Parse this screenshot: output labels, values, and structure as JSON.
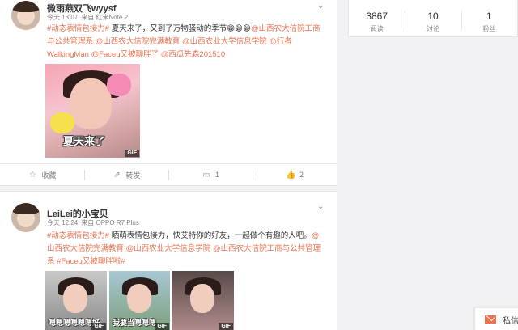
{
  "posts": [
    {
      "author": "微雨燕双飞wyysf",
      "time": "今天 13:07",
      "via": "来自 红米Note 2",
      "text": [
        {
          "t": "#动态表情包接力#",
          "link": true
        },
        {
          "t": " 夏天来了，又到了万物骚动的季节😁😁😁",
          "link": false
        },
        {
          "t": "@山西农大信院工商与公共管理系",
          "link": true
        },
        {
          "t": " ",
          "link": false
        },
        {
          "t": "@山西农大信院完满教育",
          "link": true
        },
        {
          "t": " ",
          "link": false
        },
        {
          "t": "@山西农业大学信息学院",
          "link": true
        },
        {
          "t": " ",
          "link": false
        },
        {
          "t": "@行者WalkingMan",
          "link": true
        },
        {
          "t": " ",
          "link": false
        },
        {
          "t": "@Faceu又被聊胖了",
          "link": true
        },
        {
          "t": " ",
          "link": false
        },
        {
          "t": "@西瓜先森201510",
          "link": true
        }
      ],
      "image_caption": "夏天来了",
      "gif_badge": "GIF",
      "actions": {
        "favorite": "收藏",
        "forward": "转发",
        "comment": "1",
        "like": "2"
      }
    },
    {
      "author": "LeiLei的小宝贝",
      "time": "今天 12:24",
      "via": "来自 OPPO R7 Plus",
      "text": [
        {
          "t": "#动态表情包接力#",
          "link": true
        },
        {
          "t": " 晒萌表情包接力，快艾特你的好友，一起做个有趣的人吧。",
          "link": false
        },
        {
          "t": "@山西农大信院完满教育",
          "link": true
        },
        {
          "t": " ",
          "link": false
        },
        {
          "t": "@山西农业大学信息学院",
          "link": true
        },
        {
          "t": " ",
          "link": false
        },
        {
          "t": "@山西农大信院工商与公共管理系",
          "link": true
        },
        {
          "t": " ",
          "link": false
        },
        {
          "t": "#Faceu又被聊胖啦#",
          "link": true
        }
      ],
      "images": [
        {
          "caption": "嗯嗯嗯嗯嗯嗯好",
          "gif": "GIF"
        },
        {
          "caption": "我要当嗯嗯嗯",
          "gif": "GIF"
        },
        {
          "caption": "",
          "gif": "GIF"
        }
      ]
    }
  ],
  "stats": [
    {
      "num": "3867",
      "label": "阅读"
    },
    {
      "num": "10",
      "label": "讨论"
    },
    {
      "num": "1",
      "label": "粉丝"
    }
  ],
  "messages": {
    "label": "私信"
  },
  "icons": {
    "chevron": "chevron-down-icon",
    "favorite": "star-icon",
    "forward": "forward-icon",
    "comment": "comment-icon",
    "like": "thumbs-up-icon",
    "mail": "envelope-icon"
  },
  "colors": {
    "link": "#eb7350",
    "text": "#333333",
    "meta": "#808080",
    "background": "#f2f2f5"
  }
}
